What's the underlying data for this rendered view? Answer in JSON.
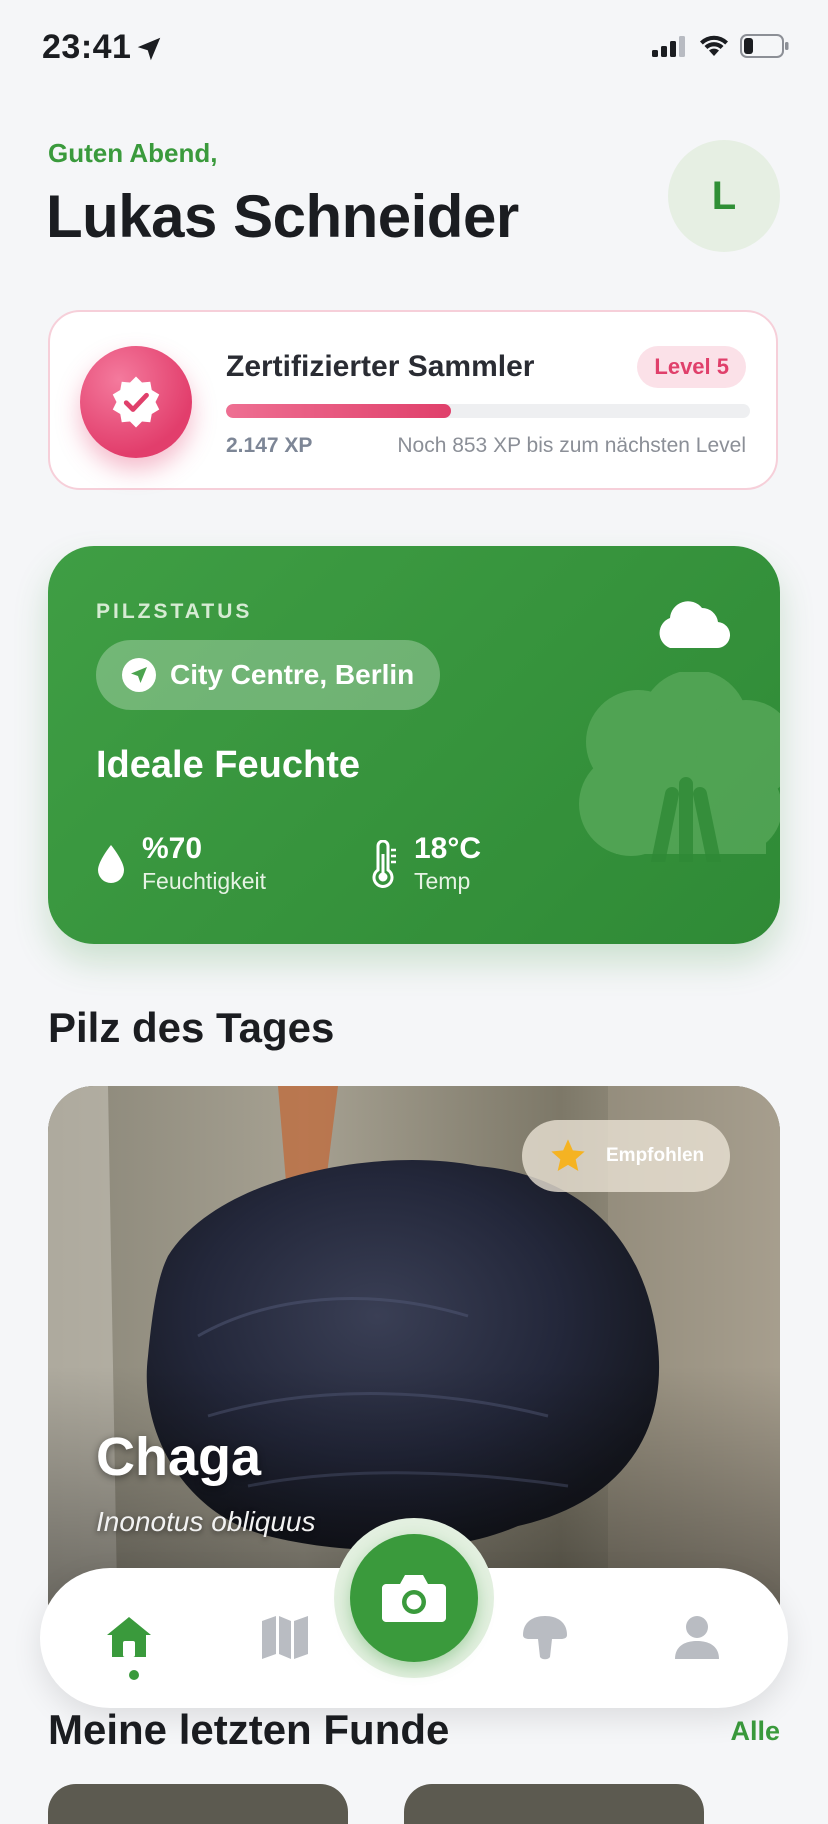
{
  "status_bar": {
    "time": "23:41",
    "icons": [
      "location-arrow-icon",
      "signal-icon",
      "wifi-icon",
      "battery-icon"
    ]
  },
  "header": {
    "greeting": "Guten Abend,",
    "user_name": "Lukas Schneider",
    "avatar_initial": "L"
  },
  "level_card": {
    "title": "Zertifizierter Sammler",
    "level_label": "Level 5",
    "xp_current": "2.147 XP",
    "xp_remaining": "Noch 853 XP bis zum nächsten Level",
    "progress_fraction": 0.43,
    "badge_icon": "verified-badge-icon",
    "accent": "#e0406b"
  },
  "status_card": {
    "label": "PILZSTATUS",
    "location": "City Centre, Berlin",
    "headline": "Ideale Feuchte",
    "humidity_value": "%70",
    "humidity_label": "Feuchtigkeit",
    "temp_value": "18°C",
    "temp_label": "Temp",
    "weather_icon": "cloud-icon",
    "accent": "#3a9a3c"
  },
  "mushroom_of_day": {
    "heading": "Pilz des Tages",
    "badge": "Empfohlen",
    "name": "Chaga",
    "latin_name": "Inonotus obliquus"
  },
  "bottom_nav": {
    "items": [
      "home-icon",
      "map-icon",
      "camera-icon",
      "mushroom-icon",
      "profile-icon"
    ],
    "active": "home-icon"
  },
  "recent_finds": {
    "heading": "Meine letzten Funde",
    "see_all": "Alle"
  }
}
